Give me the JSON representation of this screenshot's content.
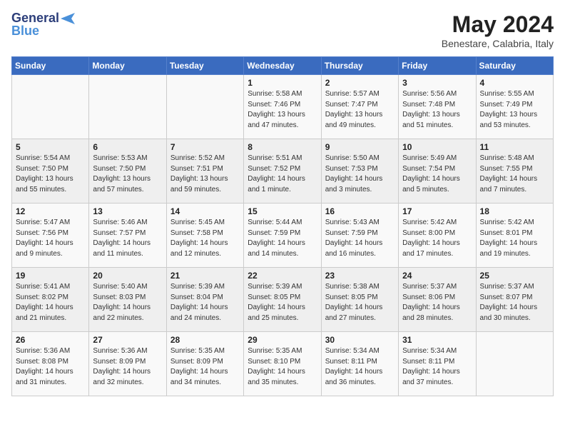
{
  "header": {
    "logo_line1": "General",
    "logo_line2": "Blue",
    "month_title": "May 2024",
    "location": "Benestare, Calabria, Italy"
  },
  "weekdays": [
    "Sunday",
    "Monday",
    "Tuesday",
    "Wednesday",
    "Thursday",
    "Friday",
    "Saturday"
  ],
  "weeks": [
    [
      {
        "day": "",
        "info": ""
      },
      {
        "day": "",
        "info": ""
      },
      {
        "day": "",
        "info": ""
      },
      {
        "day": "1",
        "info": "Sunrise: 5:58 AM\nSunset: 7:46 PM\nDaylight: 13 hours\nand 47 minutes."
      },
      {
        "day": "2",
        "info": "Sunrise: 5:57 AM\nSunset: 7:47 PM\nDaylight: 13 hours\nand 49 minutes."
      },
      {
        "day": "3",
        "info": "Sunrise: 5:56 AM\nSunset: 7:48 PM\nDaylight: 13 hours\nand 51 minutes."
      },
      {
        "day": "4",
        "info": "Sunrise: 5:55 AM\nSunset: 7:49 PM\nDaylight: 13 hours\nand 53 minutes."
      }
    ],
    [
      {
        "day": "5",
        "info": "Sunrise: 5:54 AM\nSunset: 7:50 PM\nDaylight: 13 hours\nand 55 minutes."
      },
      {
        "day": "6",
        "info": "Sunrise: 5:53 AM\nSunset: 7:50 PM\nDaylight: 13 hours\nand 57 minutes."
      },
      {
        "day": "7",
        "info": "Sunrise: 5:52 AM\nSunset: 7:51 PM\nDaylight: 13 hours\nand 59 minutes."
      },
      {
        "day": "8",
        "info": "Sunrise: 5:51 AM\nSunset: 7:52 PM\nDaylight: 14 hours\nand 1 minute."
      },
      {
        "day": "9",
        "info": "Sunrise: 5:50 AM\nSunset: 7:53 PM\nDaylight: 14 hours\nand 3 minutes."
      },
      {
        "day": "10",
        "info": "Sunrise: 5:49 AM\nSunset: 7:54 PM\nDaylight: 14 hours\nand 5 minutes."
      },
      {
        "day": "11",
        "info": "Sunrise: 5:48 AM\nSunset: 7:55 PM\nDaylight: 14 hours\nand 7 minutes."
      }
    ],
    [
      {
        "day": "12",
        "info": "Sunrise: 5:47 AM\nSunset: 7:56 PM\nDaylight: 14 hours\nand 9 minutes."
      },
      {
        "day": "13",
        "info": "Sunrise: 5:46 AM\nSunset: 7:57 PM\nDaylight: 14 hours\nand 11 minutes."
      },
      {
        "day": "14",
        "info": "Sunrise: 5:45 AM\nSunset: 7:58 PM\nDaylight: 14 hours\nand 12 minutes."
      },
      {
        "day": "15",
        "info": "Sunrise: 5:44 AM\nSunset: 7:59 PM\nDaylight: 14 hours\nand 14 minutes."
      },
      {
        "day": "16",
        "info": "Sunrise: 5:43 AM\nSunset: 7:59 PM\nDaylight: 14 hours\nand 16 minutes."
      },
      {
        "day": "17",
        "info": "Sunrise: 5:42 AM\nSunset: 8:00 PM\nDaylight: 14 hours\nand 17 minutes."
      },
      {
        "day": "18",
        "info": "Sunrise: 5:42 AM\nSunset: 8:01 PM\nDaylight: 14 hours\nand 19 minutes."
      }
    ],
    [
      {
        "day": "19",
        "info": "Sunrise: 5:41 AM\nSunset: 8:02 PM\nDaylight: 14 hours\nand 21 minutes."
      },
      {
        "day": "20",
        "info": "Sunrise: 5:40 AM\nSunset: 8:03 PM\nDaylight: 14 hours\nand 22 minutes."
      },
      {
        "day": "21",
        "info": "Sunrise: 5:39 AM\nSunset: 8:04 PM\nDaylight: 14 hours\nand 24 minutes."
      },
      {
        "day": "22",
        "info": "Sunrise: 5:39 AM\nSunset: 8:05 PM\nDaylight: 14 hours\nand 25 minutes."
      },
      {
        "day": "23",
        "info": "Sunrise: 5:38 AM\nSunset: 8:05 PM\nDaylight: 14 hours\nand 27 minutes."
      },
      {
        "day": "24",
        "info": "Sunrise: 5:37 AM\nSunset: 8:06 PM\nDaylight: 14 hours\nand 28 minutes."
      },
      {
        "day": "25",
        "info": "Sunrise: 5:37 AM\nSunset: 8:07 PM\nDaylight: 14 hours\nand 30 minutes."
      }
    ],
    [
      {
        "day": "26",
        "info": "Sunrise: 5:36 AM\nSunset: 8:08 PM\nDaylight: 14 hours\nand 31 minutes."
      },
      {
        "day": "27",
        "info": "Sunrise: 5:36 AM\nSunset: 8:09 PM\nDaylight: 14 hours\nand 32 minutes."
      },
      {
        "day": "28",
        "info": "Sunrise: 5:35 AM\nSunset: 8:09 PM\nDaylight: 14 hours\nand 34 minutes."
      },
      {
        "day": "29",
        "info": "Sunrise: 5:35 AM\nSunset: 8:10 PM\nDaylight: 14 hours\nand 35 minutes."
      },
      {
        "day": "30",
        "info": "Sunrise: 5:34 AM\nSunset: 8:11 PM\nDaylight: 14 hours\nand 36 minutes."
      },
      {
        "day": "31",
        "info": "Sunrise: 5:34 AM\nSunset: 8:11 PM\nDaylight: 14 hours\nand 37 minutes."
      },
      {
        "day": "",
        "info": ""
      }
    ]
  ]
}
